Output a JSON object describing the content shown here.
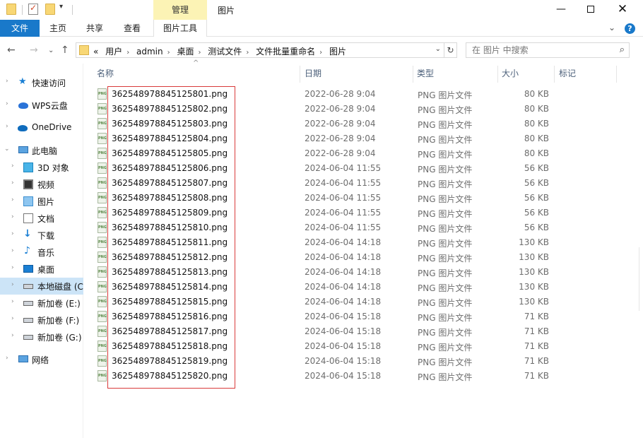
{
  "titlebar": {
    "manage_tab": "管理",
    "window_title": "图片"
  },
  "ribbon": {
    "file": "文件",
    "home": "主页",
    "share": "共享",
    "view": "查看",
    "picture_tools": "图片工具"
  },
  "address": {
    "overflow": "«",
    "crumbs": [
      "用户",
      "admin",
      "桌面",
      "测试文件",
      "文件批量重命名",
      "图片"
    ],
    "search_placeholder": "在 图片 中搜索"
  },
  "sidebar": {
    "items": [
      {
        "label": "快速访问",
        "icon": "star-icon"
      },
      {
        "label": "WPS云盘",
        "icon": "wps-cloud-icon"
      },
      {
        "label": "OneDrive",
        "icon": "onedrive-icon"
      },
      {
        "label": "此电脑",
        "icon": "this-pc-icon"
      },
      {
        "label": "3D 对象",
        "icon": "3d-objects-icon"
      },
      {
        "label": "视频",
        "icon": "videos-icon"
      },
      {
        "label": "图片",
        "icon": "pictures-icon"
      },
      {
        "label": "文档",
        "icon": "documents-icon"
      },
      {
        "label": "下载",
        "icon": "downloads-icon"
      },
      {
        "label": "音乐",
        "icon": "music-icon"
      },
      {
        "label": "桌面",
        "icon": "desktop-icon"
      },
      {
        "label": "本地磁盘 (C",
        "icon": "local-disk-icon"
      },
      {
        "label": "新加卷 (E:)",
        "icon": "drive-icon"
      },
      {
        "label": "新加卷 (F:)",
        "icon": "drive-icon"
      },
      {
        "label": "新加卷 (G:)",
        "icon": "drive-icon"
      },
      {
        "label": "网络",
        "icon": "network-icon"
      }
    ]
  },
  "columns": {
    "name": "名称",
    "date": "日期",
    "type": "类型",
    "size": "大小",
    "tags": "标记"
  },
  "icon_label": "PNG",
  "files": [
    {
      "name": "362548978845125801.png",
      "date": "2022-06-28 9:04",
      "type": "PNG 图片文件",
      "size": "80 KB"
    },
    {
      "name": "362548978845125802.png",
      "date": "2022-06-28 9:04",
      "type": "PNG 图片文件",
      "size": "80 KB"
    },
    {
      "name": "362548978845125803.png",
      "date": "2022-06-28 9:04",
      "type": "PNG 图片文件",
      "size": "80 KB"
    },
    {
      "name": "362548978845125804.png",
      "date": "2022-06-28 9:04",
      "type": "PNG 图片文件",
      "size": "80 KB"
    },
    {
      "name": "362548978845125805.png",
      "date": "2022-06-28 9:04",
      "type": "PNG 图片文件",
      "size": "80 KB"
    },
    {
      "name": "362548978845125806.png",
      "date": "2024-06-04 11:55",
      "type": "PNG 图片文件",
      "size": "56 KB"
    },
    {
      "name": "362548978845125807.png",
      "date": "2024-06-04 11:55",
      "type": "PNG 图片文件",
      "size": "56 KB"
    },
    {
      "name": "362548978845125808.png",
      "date": "2024-06-04 11:55",
      "type": "PNG 图片文件",
      "size": "56 KB"
    },
    {
      "name": "362548978845125809.png",
      "date": "2024-06-04 11:55",
      "type": "PNG 图片文件",
      "size": "56 KB"
    },
    {
      "name": "362548978845125810.png",
      "date": "2024-06-04 11:55",
      "type": "PNG 图片文件",
      "size": "56 KB"
    },
    {
      "name": "362548978845125811.png",
      "date": "2024-06-04 14:18",
      "type": "PNG 图片文件",
      "size": "130 KB"
    },
    {
      "name": "362548978845125812.png",
      "date": "2024-06-04 14:18",
      "type": "PNG 图片文件",
      "size": "130 KB"
    },
    {
      "name": "362548978845125813.png",
      "date": "2024-06-04 14:18",
      "type": "PNG 图片文件",
      "size": "130 KB"
    },
    {
      "name": "362548978845125814.png",
      "date": "2024-06-04 14:18",
      "type": "PNG 图片文件",
      "size": "130 KB"
    },
    {
      "name": "362548978845125815.png",
      "date": "2024-06-04 14:18",
      "type": "PNG 图片文件",
      "size": "130 KB"
    },
    {
      "name": "362548978845125816.png",
      "date": "2024-06-04 15:18",
      "type": "PNG 图片文件",
      "size": "71 KB"
    },
    {
      "name": "362548978845125817.png",
      "date": "2024-06-04 15:18",
      "type": "PNG 图片文件",
      "size": "71 KB"
    },
    {
      "name": "362548978845125818.png",
      "date": "2024-06-04 15:18",
      "type": "PNG 图片文件",
      "size": "71 KB"
    },
    {
      "name": "362548978845125819.png",
      "date": "2024-06-04 15:18",
      "type": "PNG 图片文件",
      "size": "71 KB"
    },
    {
      "name": "362548978845125820.png",
      "date": "2024-06-04 15:18",
      "type": "PNG 图片文件",
      "size": "71 KB"
    }
  ],
  "colors": {
    "file_tab": "#1979ca",
    "manage_tab": "#fcf3b5",
    "selection": "#cce4f7",
    "annotation_box": "#d93a3a",
    "column_header": "#4c607a"
  }
}
